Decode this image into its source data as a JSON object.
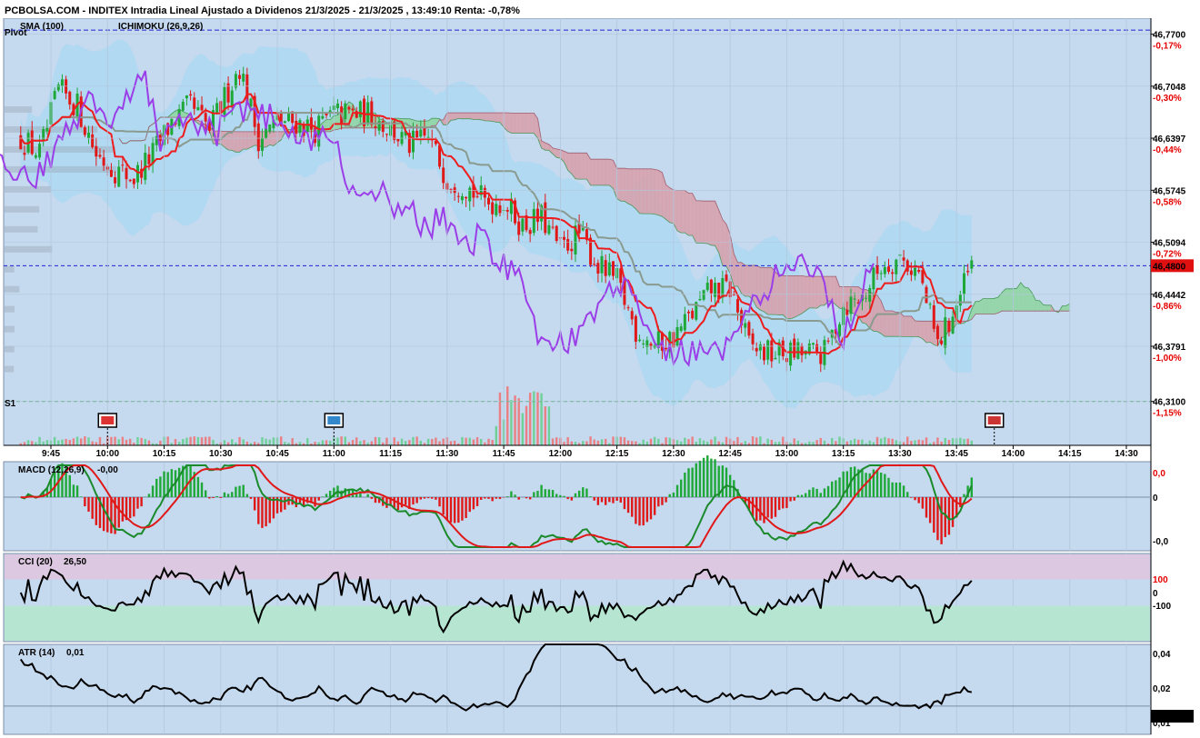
{
  "header": {
    "title": "PCBOLSA.COM - INDITEX Intradia Lineal Ajustado a Dividenos 21/3/2025 - 21/3/2025 , 13:49:10 Renta: -0,78%",
    "legend_sma": "SMA (100)",
    "legend_ichimoku": "ICHIMOKU (26,9,26)",
    "pivot_label": "Pivot",
    "s1_label": "S1"
  },
  "colors": {
    "background": "#c5d9ef",
    "grid": "#b2c6dc",
    "up_candle": "#1ea838",
    "down_candle": "#e01818",
    "tenkan": "#ee1c1c",
    "kijun": "#8a9a8e",
    "chikou": "#9b3ee8",
    "bollinger_fill": "#a9d8f3",
    "kumo_bull": "#8fd6a2",
    "kumo_bear": "#d7a0ab",
    "pivot_line": "#2222d6",
    "s1_line": "#1a9a2a"
  },
  "price_axis": {
    "levels": [
      "46,7700",
      "46,7048",
      "46,6397",
      "46,5745",
      "46,5094",
      "46,4442",
      "46,3791",
      "46,3100"
    ],
    "percents": [
      "-0,17%",
      "-0,30%",
      "-0,44%",
      "-0,58%",
      "-0,72%",
      "-0,86%",
      "-1,00%",
      "-1,15%"
    ],
    "current_price": "46,4800"
  },
  "time_axis": [
    "9:45",
    "10:00",
    "10:15",
    "10:30",
    "10:45",
    "11:00",
    "11:15",
    "11:30",
    "11:45",
    "12:00",
    "12:15",
    "12:30",
    "12:45",
    "13:00",
    "13:15",
    "13:30",
    "13:45",
    "14:00",
    "14:15",
    "14:30"
  ],
  "panels": {
    "macd": {
      "label": "MACD (12,26,9)",
      "value": "-0,00",
      "axis_top": "0,0",
      "axis_mid": "0",
      "axis_bottom": "-0,0"
    },
    "cci": {
      "label": "CCI (20)",
      "value": "26,50",
      "axis_top": "100",
      "axis_mid": "0",
      "axis_bottom": "-100"
    },
    "atr": {
      "label": "ATR (14)",
      "value": "0,01",
      "axis_top": "0,04",
      "axis_mid": "0,02",
      "axis_bottom": "0,01",
      "current": "0,017"
    }
  },
  "chart_data": [
    {
      "type": "candlestick",
      "title": "PCBOLSA.COM - INDITEX Intradia Lineal Ajustado a Dividenos 21/3/2025 - 21/3/2025 , 13:49:10 Renta: -0,78%",
      "interval_minutes": 1,
      "start_time": "09:37",
      "ylim": [
        46.255,
        46.79
      ],
      "pivot": 46.775,
      "s1": 46.31,
      "last_price": 46.48,
      "close_anchors": [
        [
          "09:37",
          46.64
        ],
        [
          "09:42",
          46.62
        ],
        [
          "09:47",
          46.7
        ],
        [
          "09:52",
          46.68
        ],
        [
          "09:57",
          46.62
        ],
        [
          "10:02",
          46.6
        ],
        [
          "10:07",
          46.59
        ],
        [
          "10:12",
          46.62
        ],
        [
          "10:17",
          46.66
        ],
        [
          "10:22",
          46.68
        ],
        [
          "10:27",
          46.65
        ],
        [
          "10:32",
          46.7
        ],
        [
          "10:35",
          46.73
        ],
        [
          "10:40",
          46.64
        ],
        [
          "10:45",
          46.66
        ],
        [
          "10:50",
          46.66
        ],
        [
          "10:55",
          46.65
        ],
        [
          "11:00",
          46.67
        ],
        [
          "11:05",
          46.67
        ],
        [
          "11:10",
          46.67
        ],
        [
          "11:15",
          46.65
        ],
        [
          "11:20",
          46.63
        ],
        [
          "11:25",
          46.64
        ],
        [
          "11:30",
          46.59
        ],
        [
          "11:35",
          46.58
        ],
        [
          "11:40",
          46.56
        ],
        [
          "11:45",
          46.56
        ],
        [
          "11:50",
          46.53
        ],
        [
          "11:55",
          46.54
        ],
        [
          "12:00",
          46.5
        ],
        [
          "12:05",
          46.52
        ],
        [
          "12:10",
          46.48
        ],
        [
          "12:15",
          46.46
        ],
        [
          "12:20",
          46.4
        ],
        [
          "12:25",
          46.38
        ],
        [
          "12:30",
          46.39
        ],
        [
          "12:35",
          46.42
        ],
        [
          "12:40",
          46.45
        ],
        [
          "12:45",
          46.45
        ],
        [
          "12:50",
          46.38
        ],
        [
          "12:55",
          46.37
        ],
        [
          "13:00",
          46.37
        ],
        [
          "13:05",
          46.37
        ],
        [
          "13:10",
          46.37
        ],
        [
          "13:15",
          46.43
        ],
        [
          "13:20",
          46.44
        ],
        [
          "13:25",
          46.48
        ],
        [
          "13:30",
          46.49
        ],
        [
          "13:35",
          46.47
        ],
        [
          "13:40",
          46.38
        ],
        [
          "13:45",
          46.43
        ],
        [
          "13:49",
          46.48
        ]
      ],
      "volume_spike_time": "11:50",
      "macd_range": [
        -0.02,
        0.02
      ],
      "cci_range": [
        -300,
        300
      ],
      "atr_range": [
        0.009,
        0.044
      ]
    }
  ]
}
